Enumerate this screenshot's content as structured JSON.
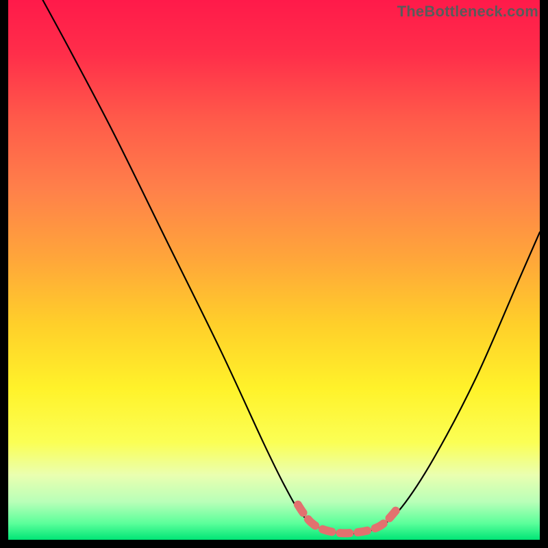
{
  "watermark": "TheBottleneck.com",
  "chart_data": {
    "type": "line",
    "title": "",
    "xlabel": "",
    "ylabel": "",
    "xlim": [
      0,
      100
    ],
    "ylim": [
      0,
      100
    ],
    "curve": {
      "description": "V-shaped bottleneck curve descending from top-left, flattening near bottom around x≈56–70, then rising toward right edge",
      "points": [
        {
          "x": 6.5,
          "y": 100
        },
        {
          "x": 12,
          "y": 90
        },
        {
          "x": 20,
          "y": 75
        },
        {
          "x": 30,
          "y": 55
        },
        {
          "x": 40,
          "y": 35
        },
        {
          "x": 48,
          "y": 18
        },
        {
          "x": 52,
          "y": 10
        },
        {
          "x": 55,
          "y": 5
        },
        {
          "x": 58,
          "y": 2.5
        },
        {
          "x": 62,
          "y": 1.3
        },
        {
          "x": 66,
          "y": 1.3
        },
        {
          "x": 70,
          "y": 2.5
        },
        {
          "x": 74,
          "y": 6
        },
        {
          "x": 80,
          "y": 15
        },
        {
          "x": 88,
          "y": 30
        },
        {
          "x": 96,
          "y": 48
        },
        {
          "x": 100,
          "y": 57
        }
      ]
    },
    "highlight_segment": {
      "color": "#e2716f",
      "points": [
        {
          "x": 54.5,
          "y": 6.5
        },
        {
          "x": 55.5,
          "y": 5
        },
        {
          "x": 57,
          "y": 3.2
        },
        {
          "x": 59,
          "y": 2
        },
        {
          "x": 62,
          "y": 1.3
        },
        {
          "x": 65,
          "y": 1.3
        },
        {
          "x": 68,
          "y": 1.8
        },
        {
          "x": 70,
          "y": 2.6
        },
        {
          "x": 71.5,
          "y": 3.8
        },
        {
          "x": 73,
          "y": 5.5
        }
      ]
    },
    "background_gradient": {
      "stops": [
        {
          "offset": 0.0,
          "color": "#ff1a4a"
        },
        {
          "offset": 0.1,
          "color": "#ff2e4a"
        },
        {
          "offset": 0.22,
          "color": "#ff5a4a"
        },
        {
          "offset": 0.35,
          "color": "#ff804a"
        },
        {
          "offset": 0.48,
          "color": "#ffa63a"
        },
        {
          "offset": 0.6,
          "color": "#ffcf2a"
        },
        {
          "offset": 0.72,
          "color": "#fff22a"
        },
        {
          "offset": 0.82,
          "color": "#fbff55"
        },
        {
          "offset": 0.88,
          "color": "#eaffb0"
        },
        {
          "offset": 0.93,
          "color": "#b8ffb8"
        },
        {
          "offset": 0.97,
          "color": "#5aff9a"
        },
        {
          "offset": 1.0,
          "color": "#00e576"
        }
      ]
    }
  }
}
